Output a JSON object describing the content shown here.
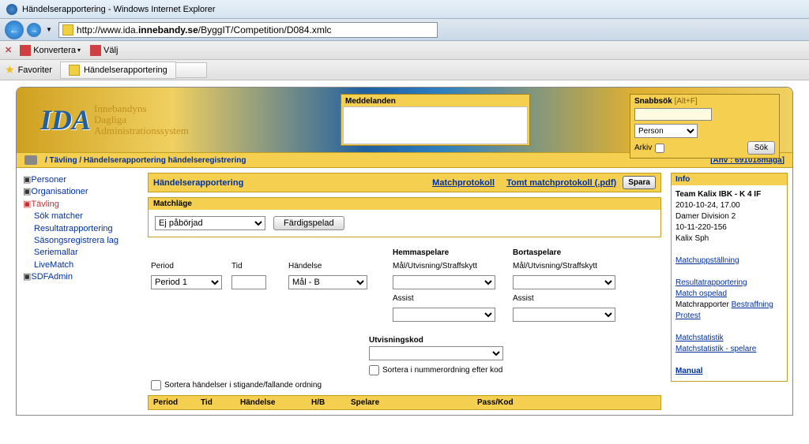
{
  "browser": {
    "title": "Händelserapportering - Windows Internet Explorer",
    "url_prefix": "http://www.ida.",
    "url_bold": "innebandy.se",
    "url_suffix": "/ByggIT/Competition/D084.xmlc",
    "konvertera": "Konvertera",
    "valj": "Välj",
    "favoriter": "Favoriter",
    "tab_title": "Händelserapportering"
  },
  "banner": {
    "logo_line1": "Innebandyns",
    "logo_line2": "Dagliga",
    "logo_line3": "Administrationssystem",
    "meddelanden": "Meddelanden",
    "snabbsok": "Snabbsök",
    "snabbsok_alt": "[Alt+F]",
    "person": "Person",
    "arkiv": "Arkiv",
    "sok": "Sök"
  },
  "breadcrumb": {
    "path": "/ Tävling / Händelserapportering händelseregistrering",
    "user": "[Anv : 691018maga]"
  },
  "leftnav": {
    "personer": "Personer",
    "organisationer": "Organisationer",
    "tavling": "Tävling",
    "sok_matcher": "Sök matcher",
    "resultatrapportering": "Resultatrapportering",
    "sasongsregistrera": "Säsongsregistrera lag",
    "seriemallar": "Seriemallar",
    "livematch": "LiveMatch",
    "sdfadmin": "SDFAdmin"
  },
  "center": {
    "heading": "Händelserapportering",
    "matchprotokoll": "Matchprotokoll",
    "tomt_matchprotokoll": "Tomt matchprotokoll (.pdf)",
    "spara": "Spara",
    "matchlage": "Matchläge",
    "ej_paborjad": "Ej påbörjad",
    "fardigspelad": "Färdigspelad",
    "hemmaspelare": "Hemmaspelare",
    "bortaspelare": "Bortaspelare",
    "period": "Period",
    "tid": "Tid",
    "handelse": "Händelse",
    "mal_utvisning": "Mål/Utvisning/Straffskytt",
    "assist": "Assist",
    "period_1": "Period 1",
    "mal_b": "Mål - B",
    "utvisningskod": "Utvisningskod",
    "sortera_nummer": "Sortera i nummerordning efter kod",
    "sortera_handelser": "Sortera händelser i stigande/fallande ordning",
    "th_period": "Period",
    "th_tid": "Tid",
    "th_handelse": "Händelse",
    "th_hb": "H/B",
    "th_spelare": "Spelare",
    "th_passkod": "Pass/Kod"
  },
  "info": {
    "hdr": "Info",
    "team": "Team Kalix IBK - K 4 IF",
    "date": "2010-10-24, 17.00",
    "division": "Damer Division 2",
    "code": "10-11-220-156",
    "venue": "Kalix Sph",
    "matchuppstallning": "Matchuppställning",
    "resultatrapportering": "Resultatrapportering",
    "match_ospelad": "Match ospelad",
    "matchrapporter": "Matchrapporter",
    "bestraffning": "Bestraffning",
    "protest": "Protest",
    "matchstatistik": "Matchstatistik",
    "matchstatistik_spelare": "Matchstatistik - spelare",
    "manual": "Manual"
  }
}
